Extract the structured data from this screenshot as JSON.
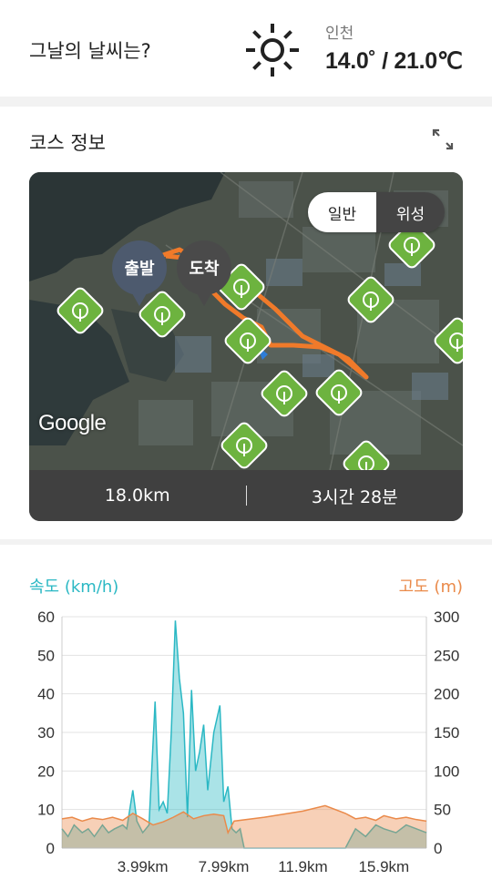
{
  "weather": {
    "question": "그날의 날씨는?",
    "icon": "sun-icon",
    "city": "인천",
    "temperature": "14.0˚ / 21.0℃"
  },
  "course": {
    "title": "코스 정보",
    "expand_icon": "expand-icon",
    "map": {
      "toggle_normal": "일반",
      "toggle_satellite": "위성",
      "selected_mode": "위성",
      "start_label": "출발",
      "end_label": "도착",
      "attribution": "Google",
      "route_color": "#f07a2a",
      "poi_icon": "forest-icon",
      "poi_color": "#6db33f"
    },
    "distance": "18.0km",
    "duration": "3시간 28분"
  },
  "chart_data": {
    "type": "area",
    "title": "",
    "series": [
      {
        "name": "속도 (km/h)",
        "axis": "left",
        "color": "#2bb8c4",
        "x": [
          0,
          0.3,
          0.6,
          1,
          1.3,
          1.6,
          2,
          2.3,
          2.6,
          3,
          3.2,
          3.5,
          3.7,
          3.99,
          4.3,
          4.6,
          4.8,
          5,
          5.2,
          5.4,
          5.6,
          5.8,
          6,
          6.2,
          6.4,
          6.6,
          6.8,
          7,
          7.2,
          7.5,
          7.8,
          7.99,
          8.2,
          8.4,
          8.6,
          8.8,
          9,
          9.2,
          9.6,
          10,
          11,
          11.9,
          12.5,
          13,
          13.5,
          14,
          14.5,
          15,
          15.5,
          15.9,
          16.5,
          17,
          17.5,
          18
        ],
        "values": [
          5,
          3,
          6,
          4,
          5,
          3,
          6,
          4,
          5,
          6,
          5,
          15,
          7,
          4,
          6,
          38,
          10,
          12,
          9,
          30,
          59,
          44,
          35,
          8,
          41,
          20,
          25,
          32,
          15,
          30,
          37,
          12,
          16,
          5,
          4,
          5,
          0,
          0,
          0,
          0,
          0,
          0,
          0,
          0,
          0,
          0,
          5,
          3,
          6,
          5,
          4,
          6,
          5,
          4
        ]
      },
      {
        "name": "고도 (m)",
        "axis": "right",
        "color": "#ea8a4a",
        "x": [
          0,
          0.5,
          1,
          1.5,
          2,
          2.5,
          3,
          3.5,
          3.99,
          4.5,
          5,
          5.5,
          6,
          6.5,
          7,
          7.5,
          7.99,
          8.2,
          8.5,
          10,
          11.9,
          13,
          14,
          14.5,
          15,
          15.5,
          15.9,
          16.5,
          17,
          17.5,
          18
        ],
        "values": [
          38,
          40,
          35,
          39,
          37,
          40,
          36,
          45,
          38,
          30,
          34,
          40,
          47,
          38,
          42,
          44,
          42,
          20,
          35,
          40,
          48,
          55,
          45,
          38,
          40,
          36,
          42,
          38,
          40,
          37,
          35
        ]
      }
    ],
    "x_ticks": [
      "3.99km",
      "7.99km",
      "11.9km",
      "15.9km"
    ],
    "x_tick_values": [
      3.99,
      7.99,
      11.9,
      15.9
    ],
    "xlim": [
      0,
      18
    ],
    "y_left": {
      "label": "속도 (km/h)",
      "ticks": [
        "0",
        "10",
        "20",
        "30",
        "40",
        "50",
        "60"
      ],
      "lim": [
        0,
        60
      ]
    },
    "y_right": {
      "label": "고도 (m)",
      "ticks": [
        "0",
        "50",
        "100",
        "150",
        "200",
        "250",
        "300"
      ],
      "lim": [
        0,
        300
      ]
    },
    "grid": true
  }
}
